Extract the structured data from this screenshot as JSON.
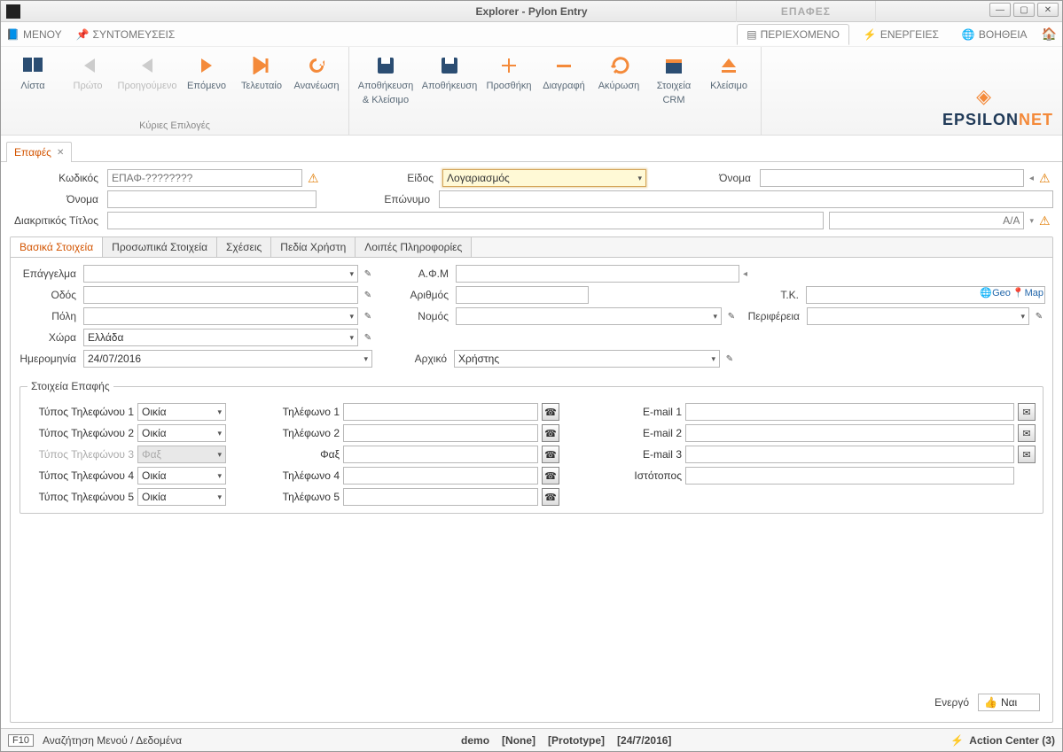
{
  "title": {
    "prefix": "Explorer - ",
    "app": "Pylon Entry"
  },
  "title_extra_tab": "ΕΠΑΦΕΣ",
  "menubar": {
    "menu": "ΜΕΝΟΥ",
    "shortcuts": "ΣΥΝΤΟΜΕΥΣΕΙΣ",
    "tabs": {
      "content": "ΠΕΡΙΕΧΟΜΕΝΟ",
      "actions": "ΕΝΕΡΓΕΙΕΣ",
      "help": "ΒΟΗΘΕΙΑ"
    }
  },
  "ribbon": {
    "list": "Λίστα",
    "first": "Πρώτο",
    "prev": "Προηγούμενο",
    "next": "Επόμενο",
    "last": "Τελευταίο",
    "refresh": "Ανανέωση",
    "saveclose_l1": "Αποθήκευση",
    "saveclose_l2": "& Κλείσιμο",
    "save": "Αποθήκευση",
    "add": "Προσθήκη",
    "delete": "Διαγραφή",
    "cancel": "Ακύρωση",
    "crm_l1": "Στοιχεία",
    "crm_l2": "CRM",
    "close": "Κλείσιμο",
    "caption": "Κύριες Επιλογές"
  },
  "logo": {
    "text": "EPSILON",
    "net": "NET"
  },
  "doc_tab": {
    "label": "Επαφές"
  },
  "header": {
    "code_label": "Κωδικός",
    "code_placeholder": "ΕΠΑΦ-????????",
    "kind_label": "Είδος",
    "kind_value": "Λογαριασμός",
    "name_label": "Όνομα",
    "firstname_label": "Όνομα",
    "lastname_label": "Επώνυμο",
    "dist_title_label": "Διακριτικός Τίτλος",
    "aa_label": "A/A"
  },
  "tabs": {
    "t1": "Βασικά Στοιχεία",
    "t2": "Προσωπικά Στοιχεία",
    "t3": "Σχέσεις",
    "t4": "Πεδία Χρήστη",
    "t5": "Λοιπές Πληροφορίες"
  },
  "basic": {
    "profession": "Επάγγελμα",
    "afm": "Α.Φ.Μ",
    "street": "Οδός",
    "number": "Αριθμός",
    "zip": "Τ.Κ.",
    "geo": "Geo",
    "map": "Map",
    "city": "Πόλη",
    "county": "Νομός",
    "region": "Περιφέρεια",
    "country": "Χώρα",
    "country_value": "Ελλάδα",
    "date": "Ημερομηνία",
    "date_value": "24/07/2016",
    "origin": "Αρχικό",
    "origin_value": "Χρήστης"
  },
  "contact": {
    "group_title": "Στοιχεία Επαφής",
    "phone_type_lbl": "Τύπος Τηλεφώνου",
    "phone_lbl": "Τηλέφωνο",
    "fax_lbl": "Φαξ",
    "email_lbl": "E-mail",
    "website_lbl": "Ιστότοπος",
    "line1_type": "Οικία",
    "line2_type": "Οικία",
    "line3_type": "Φαξ",
    "line4_type": "Οικία",
    "line5_type": "Οικία"
  },
  "active": {
    "label": "Ενεργό",
    "value": "Ναι"
  },
  "status": {
    "f10": "F10",
    "search": "Αναζήτηση Μενού / Δεδομένα",
    "demo": "demo",
    "none": "[None]",
    "proto": "[Prototype]",
    "date": "[24/7/2016]",
    "action_center": "Action Center (3)"
  }
}
